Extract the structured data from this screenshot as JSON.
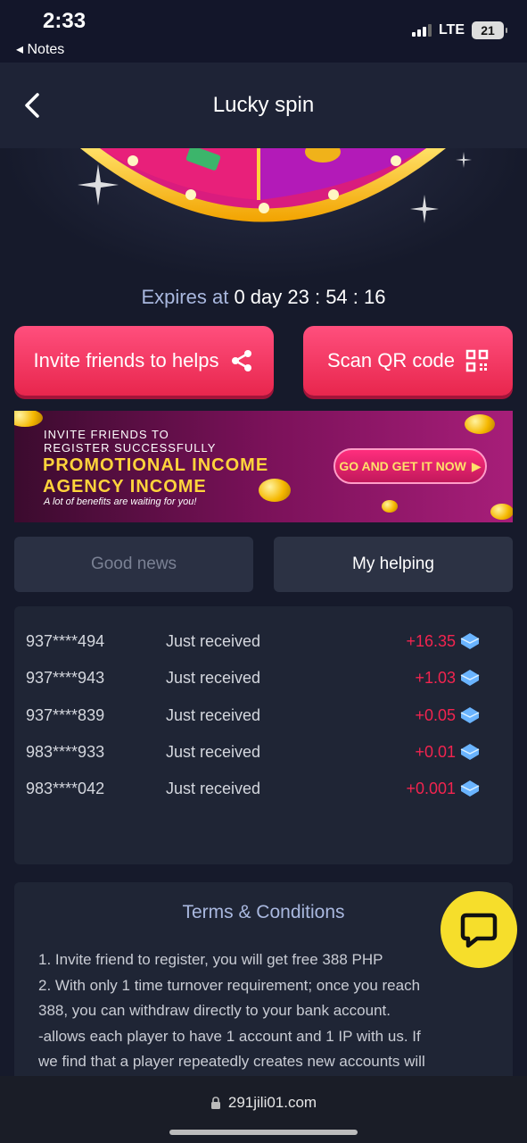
{
  "status": {
    "time": "2:33",
    "back_app": "Notes",
    "network": "LTE",
    "battery": "21"
  },
  "nav": {
    "title": "Lucky spin"
  },
  "expires": {
    "label": "Expires at",
    "value": "0 day 23 : 54 : 16"
  },
  "actions": {
    "invite_label": "Invite friends to helps",
    "scan_label": "Scan QR code"
  },
  "banner": {
    "line1": "INVITE FRIENDS TO",
    "line2": "REGISTER SUCCESSFULLY",
    "headline1": "PROMOTIONAL INCOME",
    "headline2": "AGENCY INCOME",
    "subtitle": "A lot of benefits are waiting for you!",
    "cta": "GO AND GET IT NOW"
  },
  "tabs": [
    {
      "label": "Good news",
      "active": false
    },
    {
      "label": "My helping",
      "active": true
    }
  ],
  "records": [
    {
      "user": "937****494",
      "status": "Just received",
      "amount": "+16.35"
    },
    {
      "user": "937****943",
      "status": "Just received",
      "amount": "+1.03"
    },
    {
      "user": "937****839",
      "status": "Just received",
      "amount": "+0.05"
    },
    {
      "user": "983****933",
      "status": "Just received",
      "amount": "+0.01"
    },
    {
      "user": "983****042",
      "status": "Just received",
      "amount": "+0.001"
    }
  ],
  "terms": {
    "title": "Terms & Conditions",
    "lines": [
      "1. Invite friend to register, you will get free 388 PHP",
      "2. With only 1 time turnover requirement; once you reach",
      "388, you can withdraw directly to your bank account.",
      "-allows each player to have 1 account and 1 IP with us. If",
      "we find that a player repeatedly creates new accounts will"
    ]
  },
  "browser": {
    "url": "291jili01.com"
  },
  "colors": {
    "accent": "#f2244f",
    "button": "#e8264d",
    "panel": "#1f2535",
    "background": "#161a2b",
    "chat": "#f6de2b"
  }
}
